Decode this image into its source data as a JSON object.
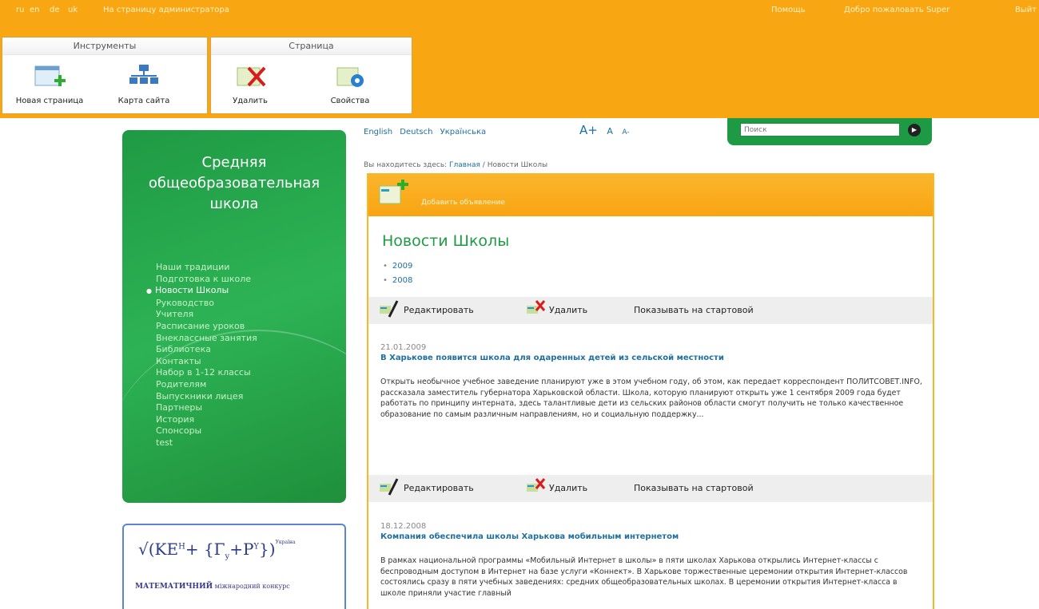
{
  "topbar": {
    "langs": [
      "ru",
      "en",
      "de",
      "uk"
    ],
    "admin_link": "На страницу администратора",
    "help": "Помощь",
    "welcome": "Добро пожаловать Super",
    "logout": "Выйт"
  },
  "toolbar": {
    "tools_group": "Инструменты",
    "page_group": "Страница",
    "new_page": "Новая страница",
    "sitemap": "Карта сайта",
    "delete": "Удалить",
    "properties": "Свойства"
  },
  "sidebar": {
    "school_title": [
      "Средняя",
      "общеобразовательная",
      "школа"
    ],
    "items": [
      "Наши традиции",
      "Подготовка к школе",
      "Новости Школы",
      "Руководство",
      "Учителя",
      "Расписание уроков",
      "Внеклассные занятия",
      "Библиотека",
      "Контакты",
      "Набор в 1-12 классы",
      "Родителям",
      "Выпускники лицея",
      "Партнеры",
      "История",
      "Спонсоры",
      "test"
    ],
    "active_index": 2
  },
  "banner": {
    "formula_part1": "(KE",
    "sup1": "H",
    "formula_part2": "+ {Γ",
    "sub1": "y",
    "formula_part3": "+P",
    "sup2": "Y",
    "formula_part4": "})",
    "tiny": "Україна",
    "title": "МАТЕМАТИЧНИЙ",
    "subtitle": "міжнародний конкурс"
  },
  "header": {
    "languages": [
      "English",
      "Deutsch",
      "Українська"
    ],
    "font_plus": "A+",
    "font_normal": "A",
    "font_minus": "A-",
    "search_placeholder": "Поиск",
    "breadcrumb_prefix": "Вы находитесь здесь:",
    "breadcrumb_home": "Главная",
    "breadcrumb_current": "/ Новости Школы"
  },
  "content": {
    "add_announcement": "Добавить объявление",
    "title": "Новости Школы",
    "years": [
      "2009",
      "2008"
    ],
    "edit_label": "Редактировать",
    "delete_label": "Удалить",
    "show_start_label": "Показывать на стартовой",
    "news": [
      {
        "date": "21.01.2009",
        "title": "В Харькове появится школа для одаренных детей из сельской местности",
        "body": "Открыть необычное учебное заведение планируют уже в этом учебном году, об этом, как передает корреспондент ПОЛИТСОВЕТ.INFO, рассказала заместитель губернатора Харьковской области. Школа, которую планируют открыть уже 1 сентября 2009 года будет работать по принципу интерната, здесь талантливые дети из сельских районов области смогут получить не только качественное образование по самым различным направлениям, но и социальную поддержку..."
      },
      {
        "date": "18.12.2008",
        "title": "Компания обеспечила школы Харькова мобильным интернетом",
        "body": "В рамках национальной программы «Мобильный Интернет в школы» в пяти школах Харькова открылись Интернет-классы с беспроводным доступом в Интернет на базе услуги «Коннект». В Харькове торжественные церемонии открытия Интернет-классов состоялись сразу в пяти учебных заведениях: средних общеобразовательных школах. В церемонии открытия Интернет-класса в школе приняли участие главный"
      }
    ]
  },
  "colors": {
    "orange": "#f9a613",
    "green": "#1f9a44",
    "link": "#1f6fa0"
  }
}
